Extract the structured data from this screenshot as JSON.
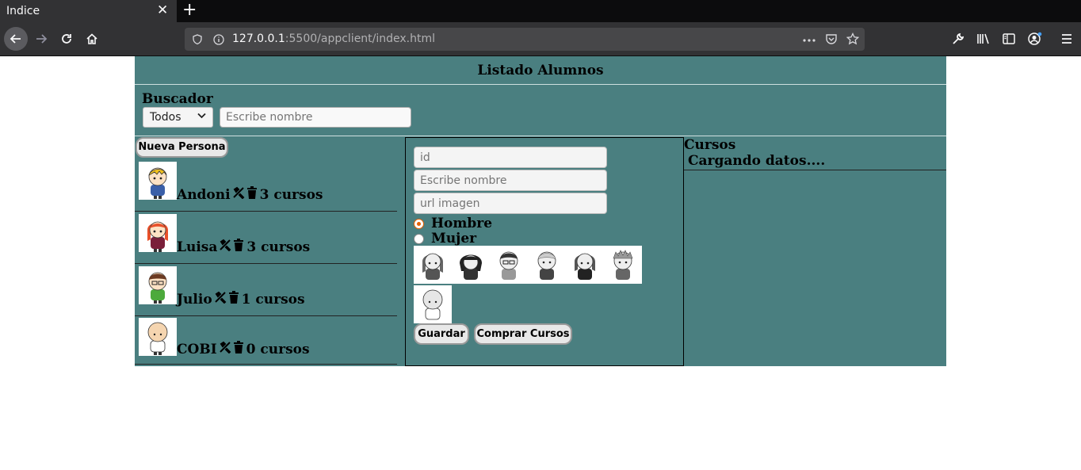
{
  "browser": {
    "tab_title": "Indice",
    "tab_close": "✕",
    "new_tab": "+",
    "url_host": "127.0.0.1",
    "url_rest": ":5500/appclient/index.html"
  },
  "header": {
    "title": "Listado Alumnos"
  },
  "search": {
    "title": "Buscador",
    "filter_selected": "Todos",
    "placeholder": "Escribe nombre"
  },
  "people": {
    "new_button": "Nueva Persona",
    "items": [
      {
        "name": "Andoni",
        "courses": "3 cursos",
        "hair": "#f0c020",
        "shirt": "#3a5fa8"
      },
      {
        "name": "Luisa",
        "courses": "3 cursos",
        "hair": "#e8502a",
        "shirt": "#7a1f3a"
      },
      {
        "name": "Julio",
        "courses": "1 cursos",
        "hair": "#6b3a22",
        "shirt": "#4caa3c"
      },
      {
        "name": "COBI",
        "courses": "0 cursos",
        "hair": "#f5d5b0",
        "shirt": "#ffffff"
      }
    ]
  },
  "form": {
    "id_placeholder": "id",
    "name_placeholder": "Escribe nombre",
    "image_placeholder": "url imagen",
    "gender_male": "Hombre",
    "gender_female": "Mujer",
    "selected_gender": "Hombre",
    "save_button": "Guardar",
    "buy_button": "Comprar Cursos"
  },
  "courses_panel": {
    "title": "Cursos",
    "status": "Cargando datos...."
  },
  "colors": {
    "page_bg": "#4a7f80",
    "browser_bg": "#323234",
    "radio_accent": "#e66000"
  }
}
